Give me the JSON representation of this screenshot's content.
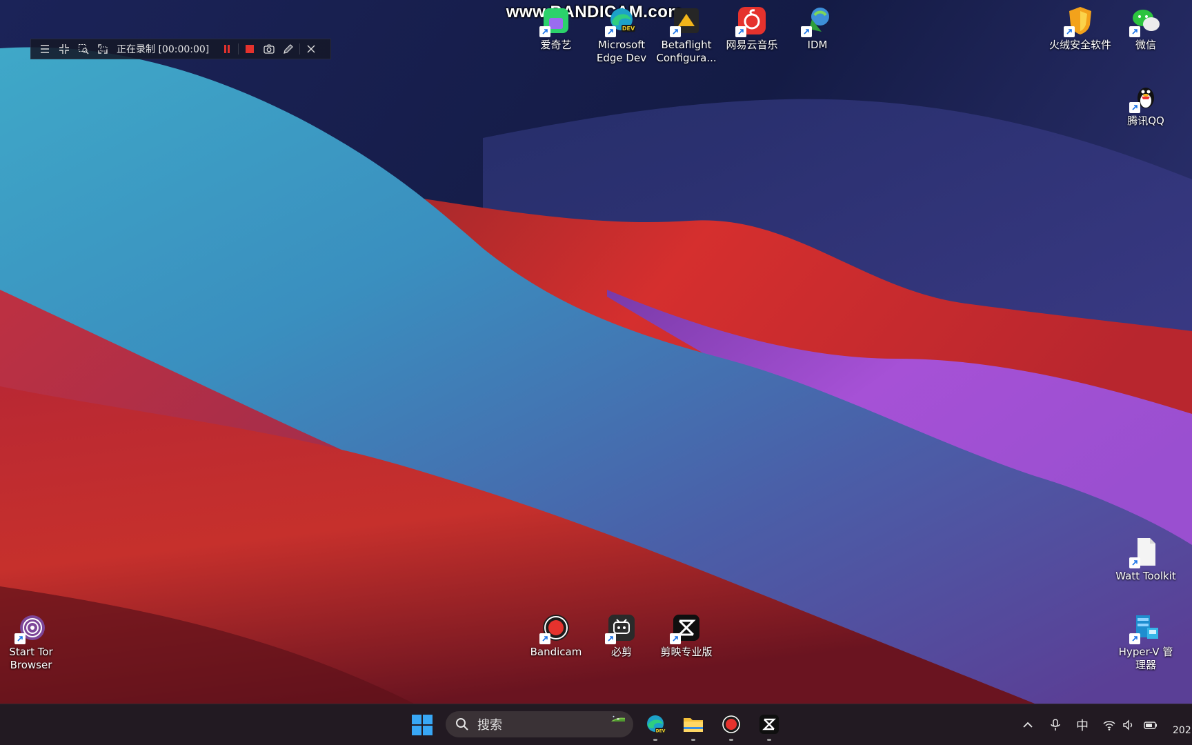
{
  "watermark": "www.BANDICAM.com",
  "recorder": {
    "status": "正在录制 [00:00:00]"
  },
  "desktop_icons": [
    {
      "id": "iqiyi",
      "label": "爱奇艺"
    },
    {
      "id": "edge-dev",
      "label": "Microsoft\nEdge Dev"
    },
    {
      "id": "betaflight",
      "label": "Betaflight\nConfigura..."
    },
    {
      "id": "netease-music",
      "label": "网易云音乐"
    },
    {
      "id": "idm",
      "label": "IDM"
    },
    {
      "id": "huorong",
      "label": "火绒安全软件"
    },
    {
      "id": "wechat",
      "label": "微信"
    },
    {
      "id": "qq",
      "label": "腾讯QQ"
    },
    {
      "id": "watt-toolkit",
      "label": "Watt Toolkit"
    },
    {
      "id": "hyperv",
      "label": "Hyper-V 管\n理器"
    },
    {
      "id": "tor",
      "label": "Start Tor\nBrowser"
    },
    {
      "id": "bandicam",
      "label": "Bandicam"
    },
    {
      "id": "bijian",
      "label": "必剪"
    },
    {
      "id": "jianying",
      "label": "剪映专业版"
    }
  ],
  "taskbar": {
    "search_placeholder": "搜索",
    "ime": "中",
    "clock": "202"
  },
  "colors": {
    "accent_red": "#e5322d",
    "taskbar_bg": "#221a22",
    "toolbar_bg": "#141828"
  }
}
